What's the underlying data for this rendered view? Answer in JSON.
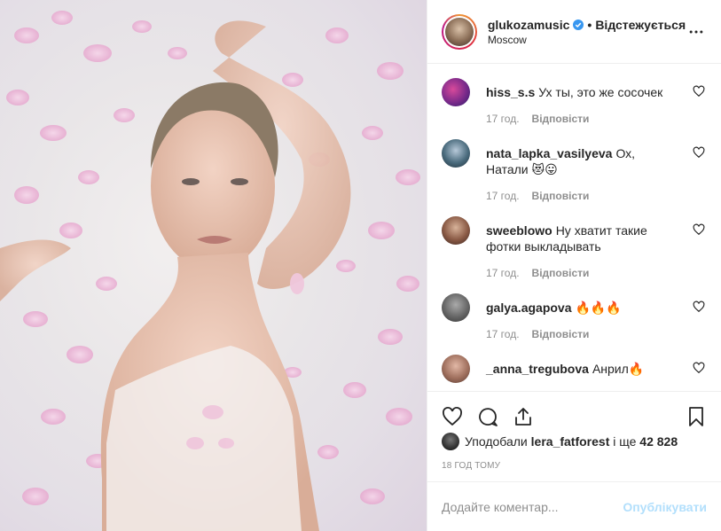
{
  "post": {
    "username": "glukozamusic",
    "separator": "•",
    "follow_label": "Відстежується",
    "location": "Moscow"
  },
  "comments": [
    {
      "user": "hiss_s.s",
      "text": "Ух ты, это же сосочек",
      "time": "17 год.",
      "reply": "Відповісти"
    },
    {
      "user": "nata_lapka_vasilyeva",
      "text": "Ох, Натали 😻😛",
      "time": "17 год.",
      "reply": "Відповісти"
    },
    {
      "user": "sweeblowo",
      "text": "Ну хватит такие фотки выкладывать",
      "time": "17 год.",
      "reply": "Відповісти"
    },
    {
      "user": "galya.agapova",
      "text": "🔥🔥🔥",
      "time": "17 год.",
      "reply": "Відповісти"
    },
    {
      "user": "_anna_tregubova",
      "text": "Анрил🔥"
    }
  ],
  "likes": {
    "prefix": "Уподобали",
    "user": "lera_fatforest",
    "middle": "і ще",
    "count": "42 828"
  },
  "timestamp": "18 ГОД ТОМУ",
  "add_comment": {
    "placeholder": "Додайте коментар...",
    "publish_label": "Опублікувати"
  },
  "colors": {
    "verified": "#3897f0",
    "publish_disabled": "#b2dffc",
    "meta": "#8e8e8e"
  }
}
